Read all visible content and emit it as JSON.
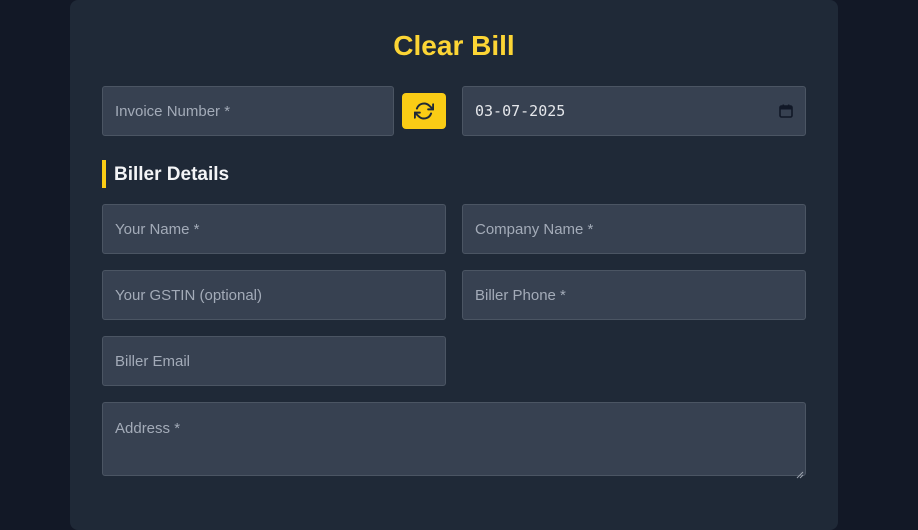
{
  "form": {
    "title": "Clear Bill",
    "invoice_number_placeholder": "Invoice Number *",
    "date_value": "03-07-2025"
  },
  "biller": {
    "section_title": "Biller Details",
    "name_placeholder": "Your Name *",
    "company_placeholder": "Company Name *",
    "gstin_placeholder": "Your GSTIN (optional)",
    "phone_placeholder": "Biller Phone *",
    "email_placeholder": "Biller Email",
    "address_placeholder": "Address *"
  },
  "icons": {
    "refresh": "refresh-icon",
    "calendar": "calendar-icon"
  },
  "colors": {
    "page_bg": "#121826",
    "card_bg": "#1f2937",
    "field_bg": "#374151",
    "accent": "#facc15",
    "title": "#fcd535"
  }
}
